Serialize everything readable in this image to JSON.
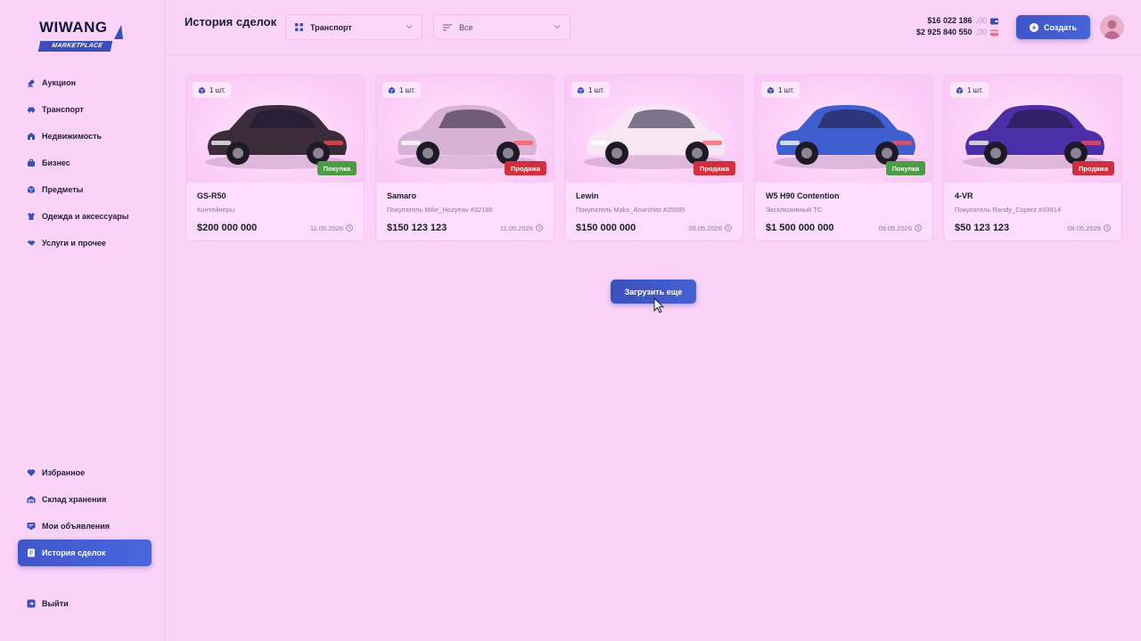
{
  "logo": {
    "top": "WIWANG",
    "bottom": "MARKETPLACE"
  },
  "sidebar": {
    "main": [
      {
        "label": "Аукцион",
        "icon": "auction-icon"
      },
      {
        "label": "Транспорт",
        "icon": "car-icon"
      },
      {
        "label": "Недвижимость",
        "icon": "building-icon"
      },
      {
        "label": "Бизнес",
        "icon": "business-icon"
      },
      {
        "label": "Предметы",
        "icon": "box-icon"
      },
      {
        "label": "Одежда и аксессуары",
        "icon": "clothes-icon"
      },
      {
        "label": "Услуги и прочее",
        "icon": "handshake-icon"
      }
    ],
    "bottom": [
      {
        "label": "Избранное",
        "icon": "heart-icon"
      },
      {
        "label": "Склад хранения",
        "icon": "warehouse-icon"
      },
      {
        "label": "Мои объявления",
        "icon": "listing-icon"
      },
      {
        "label": "История сделок",
        "icon": "history-icon",
        "active": true
      }
    ],
    "exit": {
      "label": "Выйти",
      "icon": "exit-icon"
    }
  },
  "header": {
    "title": "История сделок",
    "category_select": "Транспорт",
    "filter_select": "Все",
    "balance_main": "$16 022 186",
    "balance_main_cents": ",00",
    "balance_bank": "$2 925 840 550",
    "balance_bank_cents": ",00",
    "create_label": "Создать"
  },
  "cards": [
    {
      "qty": "1 шт.",
      "name": "GS-R50",
      "sub": "Контейнеры",
      "price": "$200 000 000",
      "date": "11.05.2026",
      "tag": "Покупка",
      "tag_type": "buy",
      "car_color": "#3a2c3a"
    },
    {
      "qty": "1 шт.",
      "name": "Samaro",
      "sub": "Покупатель Mike_Hozyeav #32186",
      "price": "$150 123 123",
      "date": "11.05.2026",
      "tag": "Продажа",
      "tag_type": "sell",
      "car_color": "#d7b2d4"
    },
    {
      "qty": "1 шт.",
      "name": "Lewin",
      "sub": "Покупатель Maks_Anarchist #25095",
      "price": "$150 000 000",
      "date": "09.05.2026",
      "tag": "Продажа",
      "tag_type": "sell",
      "car_color": "#f7e6f4"
    },
    {
      "qty": "1 шт.",
      "name": "W5 H90 Contention",
      "sub": "Эксклюзивный ТС",
      "price": "$1 500 000 000",
      "date": "09.05.2026",
      "tag": "Покупка",
      "tag_type": "buy",
      "car_color": "#3f5fcf"
    },
    {
      "qty": "1 шт.",
      "name": "4-VR",
      "sub": "Покупатель Randy_Coptez #33814",
      "price": "$50 123 123",
      "date": "08.05.2026",
      "tag": "Продажа",
      "tag_type": "sell",
      "car_color": "#4a2fa8"
    }
  ],
  "load_more_label": "Загрузить еще",
  "colors": {
    "accent": "#4660d3",
    "buy": "#4f9a46",
    "sell": "#d12e3e",
    "background": "#fbd3f9"
  }
}
